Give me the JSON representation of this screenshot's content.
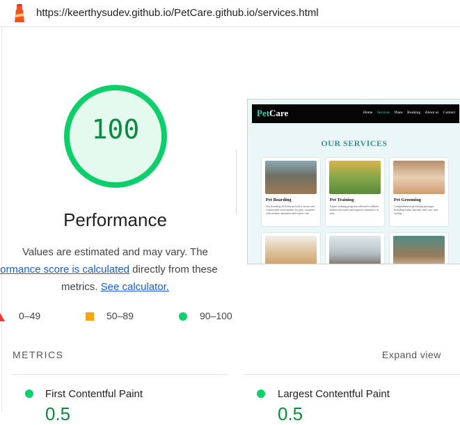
{
  "browser": {
    "url": "https://keerthysudev.github.io/PetCare.github.io/services.html"
  },
  "report": {
    "score": "100",
    "category_title": "Performance",
    "description_line1": "Values are estimated and may vary. The",
    "description_link": "performance score is calculated",
    "description_line2_rest": " directly from these",
    "description_line3_start": "metrics. ",
    "calculator_link": "See calculator.",
    "legend": {
      "fail": "0–49",
      "average": "50–89",
      "pass": "90–100"
    },
    "colors": {
      "pass": "#0cce6b",
      "average": "#ffa400",
      "fail": "#ff3333",
      "link": "#1a5cd6"
    }
  },
  "screenshot": {
    "brand_pet": "Pet",
    "brand_care": "Care",
    "nav": [
      "Home",
      "Services",
      "Plans",
      "Booking",
      "About us",
      "Contact"
    ],
    "heading": "OUR SERVICES",
    "cards": [
      {
        "title": "Pet Boarding",
        "desc": "Our boarding facilities provide a secure and comfortable environment for pets, complete with modern amenities and expert care."
      },
      {
        "title": "Pet Training",
        "desc": "Expert training programs tailored to address behavioral issues and improve obedience in pets."
      },
      {
        "title": "Pet Grooming",
        "desc": "Comprehensive grooming packages including baths, haircuts, nail care, and styling."
      },
      {
        "title": "",
        "desc": ""
      },
      {
        "title": "",
        "desc": ""
      },
      {
        "title": "",
        "desc": ""
      }
    ]
  },
  "metrics": {
    "heading": "METRICS",
    "expand_label": "Expand view",
    "items": [
      {
        "label": "First Contentful Paint",
        "value": "0.5"
      },
      {
        "label": "Largest Contentful Paint",
        "value": "0.5"
      }
    ]
  }
}
